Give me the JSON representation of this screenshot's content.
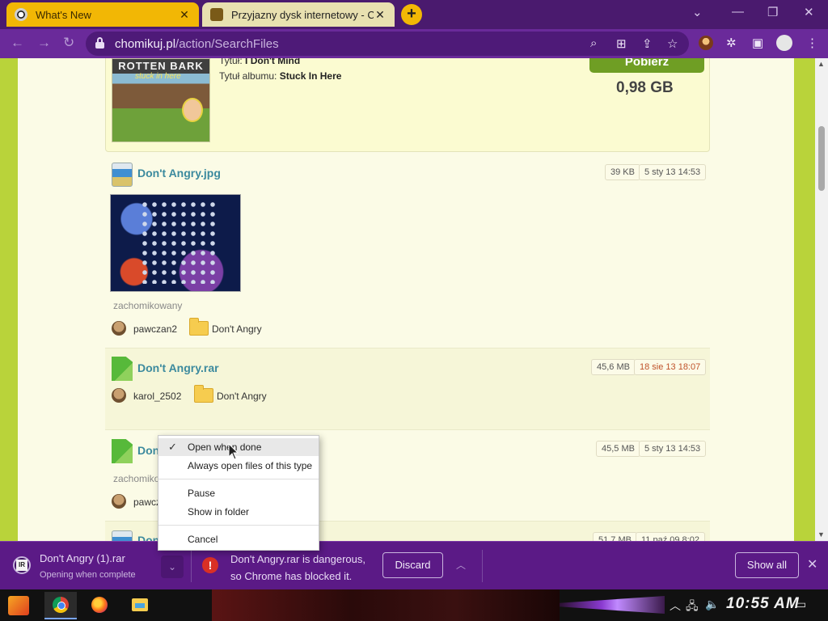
{
  "browser": {
    "tabs": [
      {
        "title": "What's New",
        "active": false
      },
      {
        "title": "Przyjazny dysk internetowy - C",
        "active": true
      }
    ],
    "new_tab_label": "+",
    "url": {
      "host": "chomikuj.pl",
      "path": "/action/SearchFiles"
    }
  },
  "top_result": {
    "cover_title": "ROTTEN BARK",
    "cover_subtitle": "stuck in here",
    "meta": [
      {
        "label": "Tytuł:",
        "value": "I Don't Mind"
      },
      {
        "label": "Tytuł albumu:",
        "value": "Stuck In Here"
      }
    ],
    "download_label": "Pobierz",
    "size": "0,98 GB"
  },
  "results": [
    {
      "name": "Don't Angry.jpg",
      "size": "39 KB",
      "date": "5 sty 13 14:53",
      "tag": "zachomikowany",
      "user": "pawczan2",
      "folder": "Don't Angry"
    },
    {
      "name": "Don't Angry.rar",
      "size": "45,6 MB",
      "date": "18 sie 13 18:07",
      "user": "karol_2502",
      "folder": "Don't Angry"
    },
    {
      "name": "Don",
      "size": "45,5 MB",
      "date": "5 sty 13 14:53",
      "tag": "zachomiko",
      "user": "pawcz"
    },
    {
      "name": "Don",
      "size": "51,7 MB",
      "date": "11 paź 09 8:02"
    }
  ],
  "context_menu": {
    "items": [
      {
        "label": "Open when done",
        "checked": true
      },
      {
        "label": "Always open files of this type"
      },
      {
        "label": "Pause"
      },
      {
        "label": "Show in folder"
      },
      {
        "label": "Cancel"
      }
    ]
  },
  "download_shelf": {
    "file_name": "Don't Angry (1).rar",
    "file_status": "Opening when complete",
    "warning_line1": "Don't Angry.rar is dangerous,",
    "warning_line2": "so Chrome has blocked it.",
    "discard_label": "Discard",
    "show_all_label": "Show all"
  },
  "taskbar": {
    "clock": "10:55 AM"
  },
  "colors": {
    "browser_frame": "#4a1a6e",
    "toolbar": "#6a2a9a",
    "page_bg": "#fbfbe6",
    "site_accent": "#b9d33a",
    "link": "#3c8a9e",
    "danger": "#d93025"
  }
}
